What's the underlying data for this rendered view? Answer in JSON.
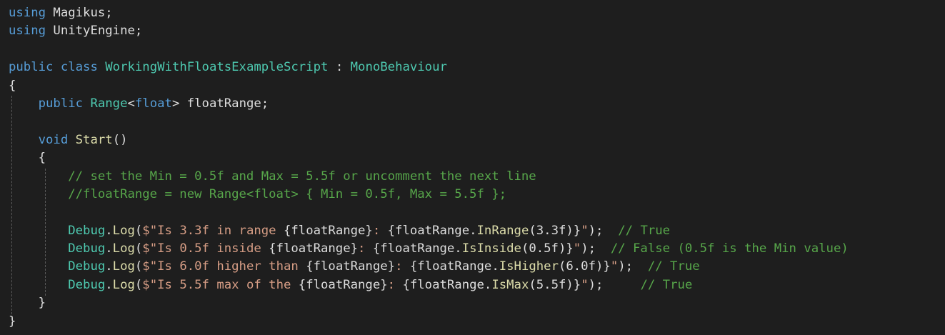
{
  "editor": {
    "lines": [
      [
        {
          "t": "using",
          "c": "kw"
        },
        {
          "t": " Magikus;",
          "c": "txt"
        }
      ],
      [
        {
          "t": "using",
          "c": "kw"
        },
        {
          "t": " UnityEngine;",
          "c": "txt"
        }
      ],
      [],
      [
        {
          "t": "public",
          "c": "kw"
        },
        {
          "t": " ",
          "c": "txt"
        },
        {
          "t": "class",
          "c": "kw"
        },
        {
          "t": " ",
          "c": "txt"
        },
        {
          "t": "WorkingWithFloatsExampleScript",
          "c": "typ"
        },
        {
          "t": " : ",
          "c": "txt"
        },
        {
          "t": "MonoBehaviour",
          "c": "typ"
        }
      ],
      [
        {
          "t": "{",
          "c": "txt"
        }
      ],
      [
        {
          "t": "    ",
          "c": "txt"
        },
        {
          "t": "public",
          "c": "kw"
        },
        {
          "t": " ",
          "c": "txt"
        },
        {
          "t": "Range",
          "c": "typ"
        },
        {
          "t": "<",
          "c": "txt"
        },
        {
          "t": "float",
          "c": "kw"
        },
        {
          "t": "> floatRange;",
          "c": "txt"
        }
      ],
      [],
      [
        {
          "t": "    ",
          "c": "txt"
        },
        {
          "t": "void",
          "c": "kw"
        },
        {
          "t": " ",
          "c": "txt"
        },
        {
          "t": "Start",
          "c": "fn"
        },
        {
          "t": "()",
          "c": "txt"
        }
      ],
      [
        {
          "t": "    {",
          "c": "txt"
        }
      ],
      [
        {
          "t": "        ",
          "c": "txt"
        },
        {
          "t": "// set the Min = 0.5f and Max = 5.5f or uncomment the next line",
          "c": "com"
        }
      ],
      [
        {
          "t": "        ",
          "c": "txt"
        },
        {
          "t": "//floatRange = new Range<float> { Min = 0.5f, Max = 5.5f };",
          "c": "com"
        }
      ],
      [],
      [
        {
          "t": "        ",
          "c": "txt"
        },
        {
          "t": "Debug",
          "c": "typ"
        },
        {
          "t": ".",
          "c": "txt"
        },
        {
          "t": "Log",
          "c": "fn"
        },
        {
          "t": "(",
          "c": "txt"
        },
        {
          "t": "$\"Is 3.3f in range ",
          "c": "str"
        },
        {
          "t": "{floatRange}",
          "c": "txt"
        },
        {
          "t": ": ",
          "c": "str"
        },
        {
          "t": "{floatRange.",
          "c": "txt"
        },
        {
          "t": "InRange",
          "c": "fn"
        },
        {
          "t": "(3.3f)}",
          "c": "txt"
        },
        {
          "t": "\"",
          "c": "str"
        },
        {
          "t": ");  ",
          "c": "txt"
        },
        {
          "t": "// True",
          "c": "com"
        }
      ],
      [
        {
          "t": "        ",
          "c": "txt"
        },
        {
          "t": "Debug",
          "c": "typ"
        },
        {
          "t": ".",
          "c": "txt"
        },
        {
          "t": "Log",
          "c": "fn"
        },
        {
          "t": "(",
          "c": "txt"
        },
        {
          "t": "$\"Is 0.5f inside ",
          "c": "str"
        },
        {
          "t": "{floatRange}",
          "c": "txt"
        },
        {
          "t": ": ",
          "c": "str"
        },
        {
          "t": "{floatRange.",
          "c": "txt"
        },
        {
          "t": "IsInside",
          "c": "fn"
        },
        {
          "t": "(0.5f)}",
          "c": "txt"
        },
        {
          "t": "\"",
          "c": "str"
        },
        {
          "t": ");  ",
          "c": "txt"
        },
        {
          "t": "// False (0.5f is the Min value)",
          "c": "com"
        }
      ],
      [
        {
          "t": "        ",
          "c": "txt"
        },
        {
          "t": "Debug",
          "c": "typ"
        },
        {
          "t": ".",
          "c": "txt"
        },
        {
          "t": "Log",
          "c": "fn"
        },
        {
          "t": "(",
          "c": "txt"
        },
        {
          "t": "$\"Is 6.0f higher than ",
          "c": "str"
        },
        {
          "t": "{floatRange}",
          "c": "txt"
        },
        {
          "t": ": ",
          "c": "str"
        },
        {
          "t": "{floatRange.",
          "c": "txt"
        },
        {
          "t": "IsHigher",
          "c": "fn"
        },
        {
          "t": "(6.0f)}",
          "c": "txt"
        },
        {
          "t": "\"",
          "c": "str"
        },
        {
          "t": ");  ",
          "c": "txt"
        },
        {
          "t": "// True",
          "c": "com"
        }
      ],
      [
        {
          "t": "        ",
          "c": "txt"
        },
        {
          "t": "Debug",
          "c": "typ"
        },
        {
          "t": ".",
          "c": "txt"
        },
        {
          "t": "Log",
          "c": "fn"
        },
        {
          "t": "(",
          "c": "txt"
        },
        {
          "t": "$\"Is 5.5f max of the ",
          "c": "str"
        },
        {
          "t": "{floatRange}",
          "c": "txt"
        },
        {
          "t": ": ",
          "c": "str"
        },
        {
          "t": "{floatRange.",
          "c": "txt"
        },
        {
          "t": "IsMax",
          "c": "fn"
        },
        {
          "t": "(5.5f)}",
          "c": "txt"
        },
        {
          "t": "\"",
          "c": "str"
        },
        {
          "t": ");     ",
          "c": "txt"
        },
        {
          "t": "// True",
          "c": "com"
        }
      ],
      [
        {
          "t": "    }",
          "c": "txt"
        }
      ],
      [
        {
          "t": "}",
          "c": "txt"
        }
      ]
    ]
  }
}
